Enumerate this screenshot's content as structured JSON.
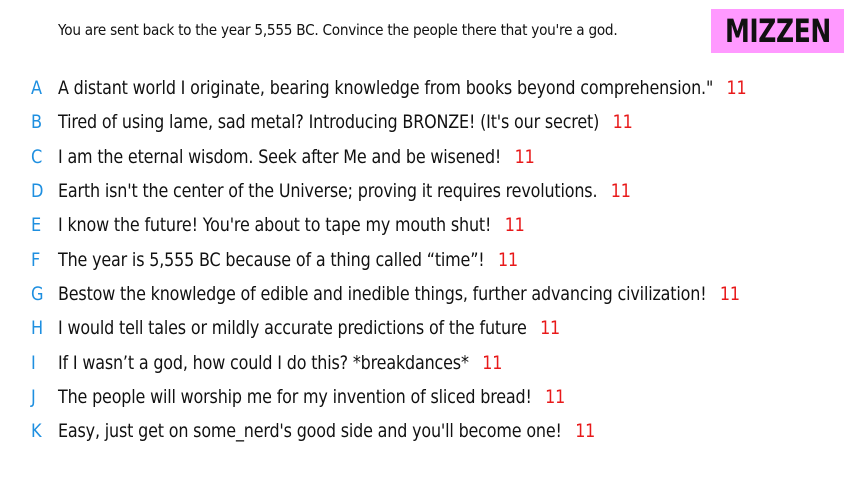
{
  "header": {
    "prompt": "You are sent back to the year 5,555 BC. Convince the people there that you're a god.",
    "badge": "MIZZEN"
  },
  "answers": [
    {
      "letter": "A",
      "text": "A distant world I originate, bearing knowledge from books beyond comprehension.\"",
      "score": "11"
    },
    {
      "letter": "B",
      "text": "Tired of using lame, sad metal? Introducing BRONZE! (It's our secret)",
      "score": "11"
    },
    {
      "letter": "C",
      "text": "I am the eternal wisdom. Seek after Me and be wisened!",
      "score": "11"
    },
    {
      "letter": "D",
      "text": "Earth isn't the center of the Universe; proving it requires revolutions.",
      "score": "11"
    },
    {
      "letter": "E",
      "text": "I know the future! You're about to tape my mouth shut!",
      "score": "11"
    },
    {
      "letter": "F",
      "text": "The year is 5,555 BC because of a thing called “time”!",
      "score": "11"
    },
    {
      "letter": "G",
      "text": "Bestow the knowledge of edible and inedible things, further advancing civilization!",
      "score": "11"
    },
    {
      "letter": "H",
      "text": "I would tell tales or mildly accurate predictions of the future",
      "score": "11"
    },
    {
      "letter": "I",
      "text": "If I wasn’t a god, how could I do this? *breakdances*",
      "score": "11"
    },
    {
      "letter": "J",
      "text": "The people will worship me for my invention of sliced bread!",
      "score": "11"
    },
    {
      "letter": "K",
      "text": "Easy, just get on some_nerd's good side and you'll become one!",
      "score": "11"
    }
  ],
  "colors": {
    "letter": "#1e8fe0",
    "score": "#e8191a",
    "badge_bg": "#ff99ff",
    "text": "#111111"
  }
}
